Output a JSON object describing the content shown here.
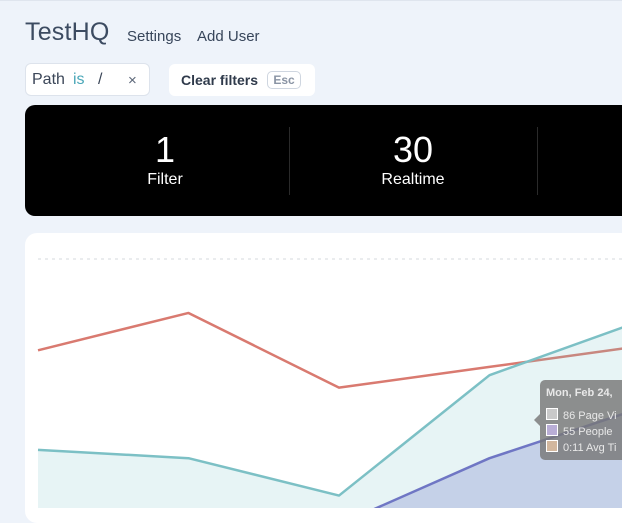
{
  "header": {
    "brand": "TestHQ",
    "nav": [
      {
        "label": "Settings"
      },
      {
        "label": "Add User"
      }
    ]
  },
  "filters": {
    "chip": {
      "field": "Path",
      "operator": "is",
      "value": "/",
      "remove_glyph": "×"
    },
    "clear_label": "Clear filters",
    "clear_shortcut": "Esc"
  },
  "stats": [
    {
      "value": "1",
      "label": "Filter"
    },
    {
      "value": "30",
      "label": "Realtime"
    }
  ],
  "colors": {
    "page_views": "#d97a70",
    "people": "#7cc0c5",
    "avg_time": "#6f76c4",
    "accent": "#4aa7b8"
  },
  "chart_data": {
    "type": "line",
    "series": [
      {
        "name": "Page Views",
        "values": [
          38,
          47,
          29,
          34,
          39
        ]
      },
      {
        "name": "People",
        "values": [
          14,
          12,
          3,
          32,
          45
        ]
      },
      {
        "name": "Avg Time",
        "values": [
          null,
          null,
          -4,
          12,
          24
        ]
      }
    ],
    "categories": [
      "",
      "",
      "",
      "",
      ""
    ],
    "ylim": [
      0,
      60
    ],
    "grid": false,
    "legend": "none"
  },
  "tooltip": {
    "title": "Mon, Feb 24,",
    "rows": [
      {
        "text": "86 Page Vi"
      },
      {
        "text": "55 People"
      },
      {
        "text": "0:11 Avg Ti"
      }
    ]
  }
}
